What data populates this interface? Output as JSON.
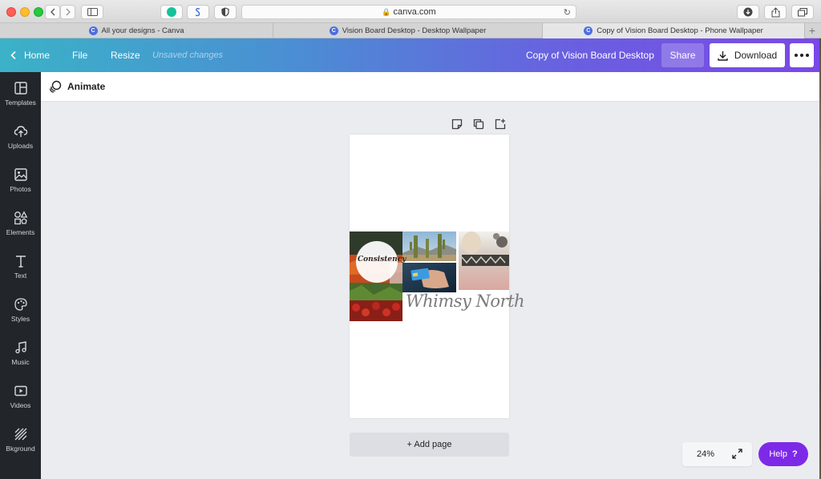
{
  "browser": {
    "address": "canva.com",
    "tabs": [
      {
        "label": "All your designs - Canva",
        "favicon": "C"
      },
      {
        "label": "Vision Board Desktop - Desktop Wallpaper",
        "favicon": "C"
      },
      {
        "label": "Copy of Vision Board Desktop - Phone Wallpaper",
        "favicon": "C"
      }
    ],
    "new_tab": "+"
  },
  "header": {
    "home": "Home",
    "file": "File",
    "resize": "Resize",
    "status": "Unsaved changes",
    "doc_title": "Copy of Vision Board Desktop",
    "share": "Share",
    "download": "Download"
  },
  "sidebar": {
    "items": [
      {
        "label": "Templates",
        "icon": "templates-icon"
      },
      {
        "label": "Uploads",
        "icon": "upload-cloud-icon"
      },
      {
        "label": "Photos",
        "icon": "image-icon"
      },
      {
        "label": "Elements",
        "icon": "shapes-icon"
      },
      {
        "label": "Text",
        "icon": "text-icon"
      },
      {
        "label": "Styles",
        "icon": "palette-icon"
      },
      {
        "label": "Music",
        "icon": "music-note-icon"
      },
      {
        "label": "Videos",
        "icon": "video-icon"
      },
      {
        "label": "Bkground",
        "icon": "background-icon"
      }
    ]
  },
  "toolbar": {
    "animate": "Animate"
  },
  "canvas": {
    "circle_text": "Consistency",
    "script_text": "Whimsy North",
    "add_page": "+ Add page"
  },
  "footer": {
    "zoom": "24%",
    "help": "Help",
    "help_icon": "?"
  },
  "colors": {
    "header_gradient_start": "#3bb2c7",
    "header_gradient_end": "#7a48e6",
    "sidebar": "#22262b",
    "help_button": "#7d2ae8"
  }
}
